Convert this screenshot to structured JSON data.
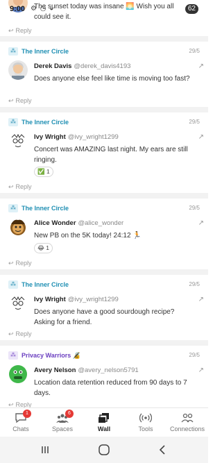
{
  "status": {
    "time": "9:00",
    "icons": "⚙ ◷ ◒",
    "notif_count": "62"
  },
  "posts": [
    {
      "space": "",
      "timestamp": "",
      "name": "",
      "handle": "",
      "body": "The sunset today was insane 🌅 Wish you all could see it.",
      "reaction": "",
      "reply": "Reply"
    },
    {
      "space": "The Inner Circle",
      "timestamp": "29/5",
      "name": "Derek Davis",
      "handle": "@derek_davis4193",
      "body": "Does anyone else feel like time is moving too fast?",
      "reaction": "",
      "reply": "Reply"
    },
    {
      "space": "The Inner Circle",
      "timestamp": "29/5",
      "name": "Ivy Wright",
      "handle": "@ivy_wright1299",
      "body": "Concert was AMAZING last night. My ears are still ringing.",
      "reaction": "✅ 1",
      "reply": "Reply"
    },
    {
      "space": "The Inner Circle",
      "timestamp": "29/5",
      "name": "Alice Wonder",
      "handle": "@alice_wonder",
      "body": "New PB on the 5K today! 24:12 🏃",
      "reaction": "😂 1",
      "reply": "Reply"
    },
    {
      "space": "The Inner Circle",
      "timestamp": "29/5",
      "name": "Ivy Wright",
      "handle": "@ivy_wright1299",
      "body": "Does anyone have a good sourdough recipe? Asking for a friend.",
      "reaction": "",
      "reply": "Reply"
    },
    {
      "space": "Privacy Warriors 🔏",
      "timestamp": "29/5",
      "name": "Avery Nelson",
      "handle": "@avery_nelson5791",
      "body": "Location data retention reduced from 90 days to 7 days.",
      "reaction": "",
      "reply": "Reply"
    }
  ],
  "tabs": [
    {
      "label": "Chats",
      "badge": "1",
      "icon": "chat-bubble-icon"
    },
    {
      "label": "Spaces",
      "badge": "6",
      "icon": "people-icon"
    },
    {
      "label": "Wall",
      "badge": "",
      "icon": "wall-stack-icon"
    },
    {
      "label": "Tools",
      "badge": "",
      "icon": "broadcast-icon"
    },
    {
      "label": "Connections",
      "badge": "",
      "icon": "contacts-icon"
    }
  ],
  "colors": {
    "space_teal": "#1f8fb3",
    "space_purple": "#6b3fc0",
    "badge_red": "#e53935"
  }
}
